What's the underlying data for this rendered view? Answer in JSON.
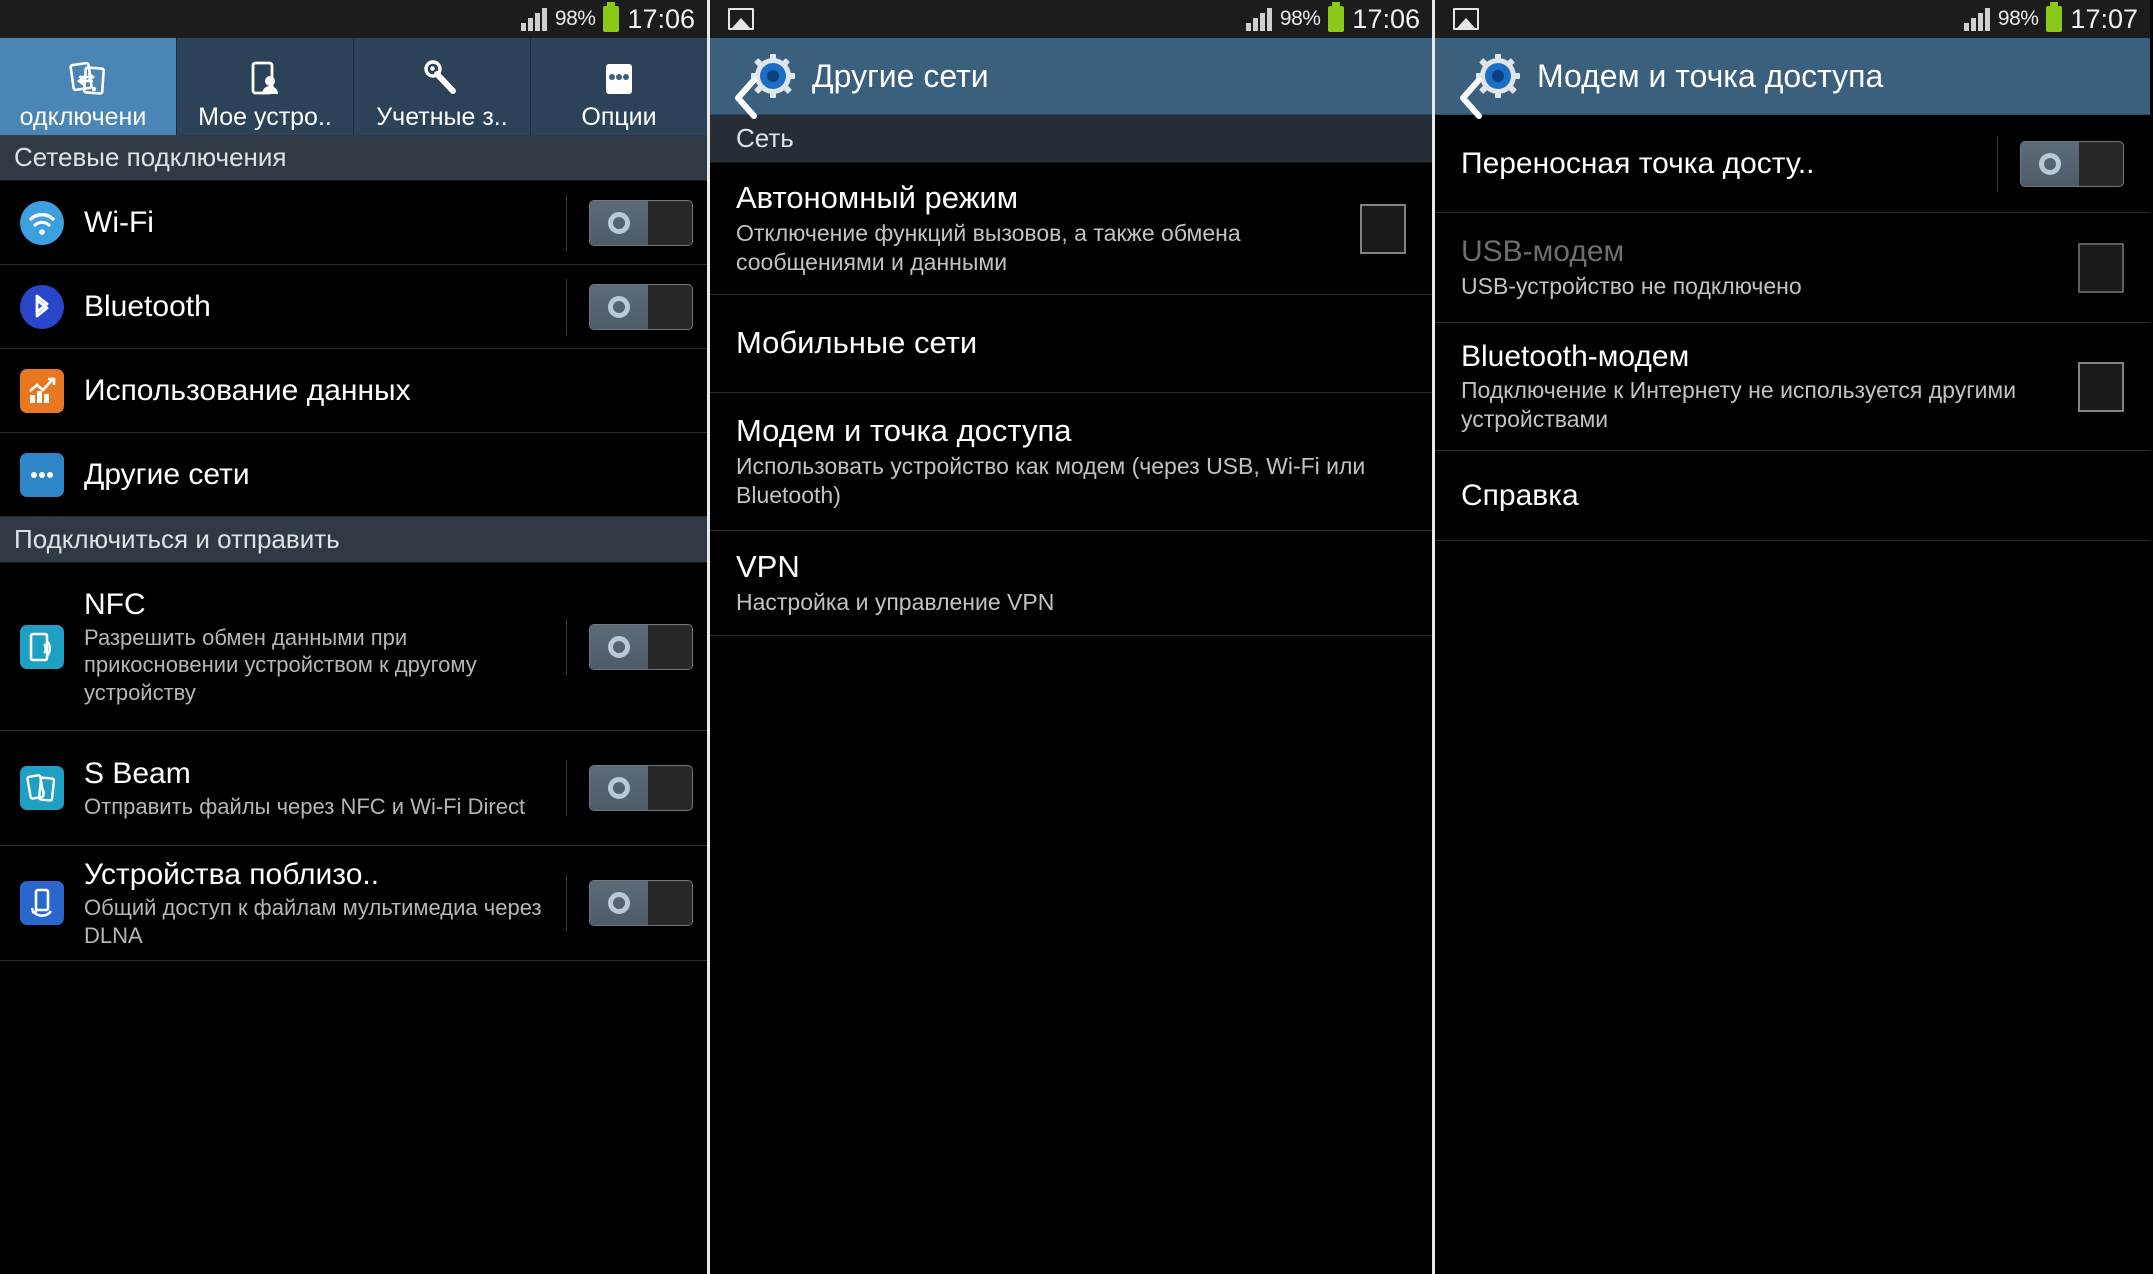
{
  "status_bar": {
    "panel1": {
      "battery_percent": "98%",
      "time": "17:06",
      "signal_icon": "signal-bars-icon",
      "battery_icon": "battery-icon"
    },
    "panel2": {
      "image_icon": "image-notification-icon",
      "battery_percent": "98%",
      "time": "17:06"
    },
    "panel3": {
      "image_icon": "image-notification-icon",
      "battery_percent": "98%",
      "time": "17:07"
    }
  },
  "panel1": {
    "tabs": [
      {
        "label": "одключени",
        "icon": "connections-icon",
        "active": true
      },
      {
        "label": "Мое устро..",
        "icon": "my-device-icon",
        "active": false
      },
      {
        "label": "Учетные з..",
        "icon": "accounts-key-icon",
        "active": false
      },
      {
        "label": "Опции",
        "icon": "more-options-icon",
        "active": false
      }
    ],
    "sections": [
      {
        "header": "Сетевые подключения",
        "rows": [
          {
            "title": "Wi-Fi",
            "sub": "",
            "icon": "wifi-icon",
            "control": "toggle",
            "on": false
          },
          {
            "title": "Bluetooth",
            "sub": "",
            "icon": "bluetooth-icon",
            "control": "toggle",
            "on": false
          },
          {
            "title": "Использование данных",
            "sub": "",
            "icon": "data-usage-icon",
            "control": "none"
          },
          {
            "title": "Другие сети",
            "sub": "",
            "icon": "more-networks-icon",
            "control": "none"
          }
        ]
      },
      {
        "header": "Подключиться и отправить",
        "rows": [
          {
            "title": "NFC",
            "sub": "Разрешить обмен данными при прикосновении устройством к другому устройству",
            "icon": "nfc-icon",
            "control": "toggle",
            "on": false
          },
          {
            "title": "S Beam",
            "sub": "Отправить файлы через NFC и Wi-Fi Direct",
            "icon": "sbeam-icon",
            "control": "toggle",
            "on": false
          },
          {
            "title": "Устройства поблизо..",
            "sub": "Общий доступ к файлам мультимедиа через DLNA",
            "icon": "nearby-devices-icon",
            "control": "toggle",
            "on": false
          }
        ]
      }
    ]
  },
  "panel2": {
    "title": "Другие сети",
    "back_icon": "back-chevron-icon",
    "gear_icon": "settings-gear-icon",
    "section_header": "Сеть",
    "rows": [
      {
        "title": "Автономный режим",
        "sub": "Отключение функций вызовов, а также обмена сообщениями и данными",
        "control": "checkbox",
        "checked": false
      },
      {
        "title": "Мобильные сети",
        "sub": "",
        "control": "none"
      },
      {
        "title": "Модем и точка доступа",
        "sub": "Использовать устройство как модем (через USB, Wi-Fi или Bluetooth)",
        "control": "none"
      },
      {
        "title": "VPN",
        "sub": "Настройка и управление VPN",
        "control": "none"
      }
    ]
  },
  "panel3": {
    "title": "Модем и точка доступа",
    "back_icon": "back-chevron-icon",
    "gear_icon": "settings-gear-icon",
    "rows": [
      {
        "title": "Переносная точка досту..",
        "sub": "",
        "control": "toggle",
        "on": false,
        "disabled": false
      },
      {
        "title": "USB-модем",
        "sub": "USB-устройство не подключено",
        "control": "checkbox",
        "checked": false,
        "disabled": true
      },
      {
        "title": "Bluetooth-модем",
        "sub": "Подключение к Интернету не используется другими устройствами",
        "control": "checkbox",
        "checked": false,
        "disabled": false
      },
      {
        "title": "Справка",
        "sub": "",
        "control": "none",
        "disabled": false
      }
    ]
  },
  "colors": {
    "accent_blue": "#4a86b5",
    "actionbar_blue": "#3b607e",
    "tabbar_blue": "#2c4258",
    "section_header": "#2f3a45",
    "battery_green": "#8bc919",
    "wifi_icon": "#3c9fe0",
    "bluetooth_icon": "#2a46c8",
    "data_usage_icon": "#e87722",
    "more_networks_icon": "#2e86c8",
    "nfc_icon": "#1f9fc4",
    "nearby_icon": "#2a66cc"
  }
}
